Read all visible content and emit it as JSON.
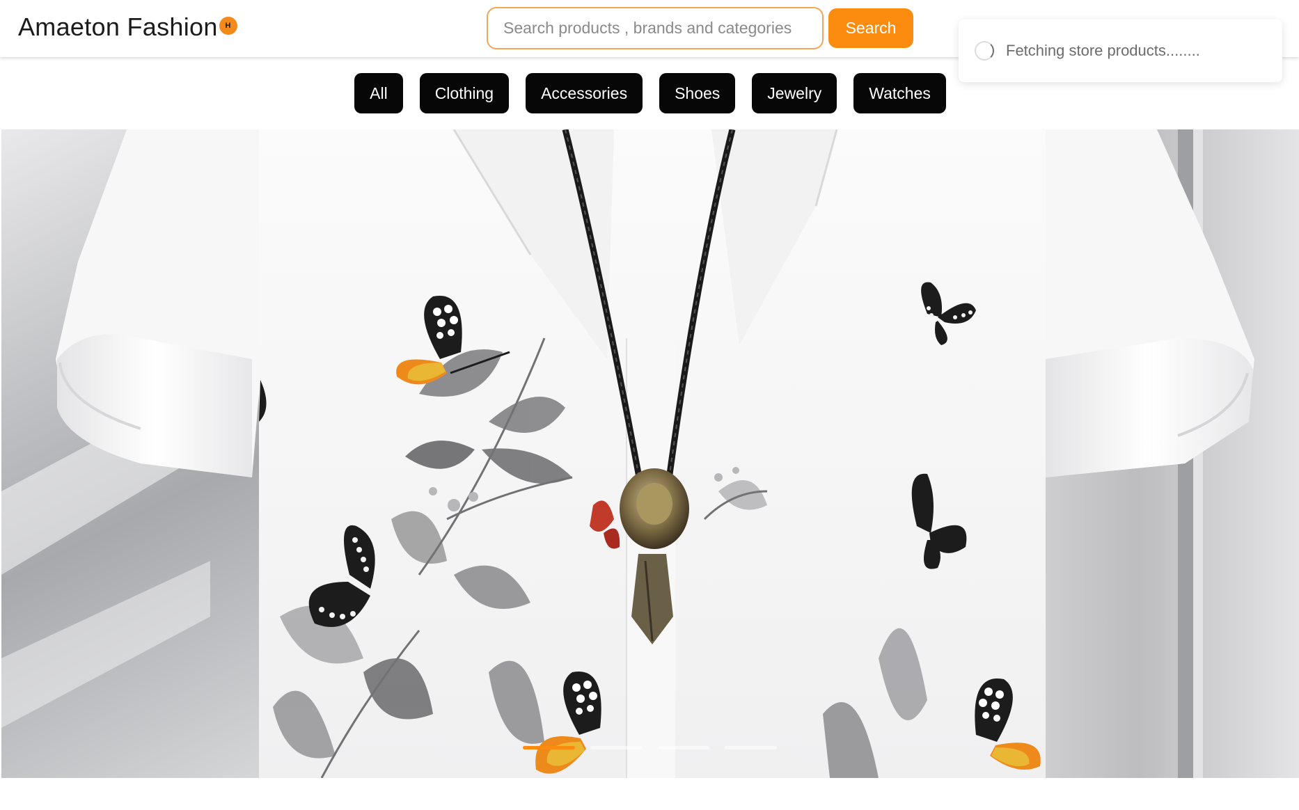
{
  "brand": {
    "name": "Amaeton Fashion",
    "badge": "H",
    "badge_color": "#f48a1a"
  },
  "search": {
    "placeholder": "Search products , brands and categories",
    "button_label": "Search",
    "accent_color": "#fb8c10"
  },
  "toast": {
    "icon": "spinner-icon",
    "message": "Fetching store products........"
  },
  "categories": [
    {
      "label": "All"
    },
    {
      "label": "Clothing"
    },
    {
      "label": "Accessories"
    },
    {
      "label": "Shoes"
    },
    {
      "label": "Jewelry"
    },
    {
      "label": "Watches"
    }
  ],
  "hero": {
    "image": "white-butterfly-print-shirt-with-bolo-tie",
    "slides_total": 4,
    "active_slide": 1
  }
}
